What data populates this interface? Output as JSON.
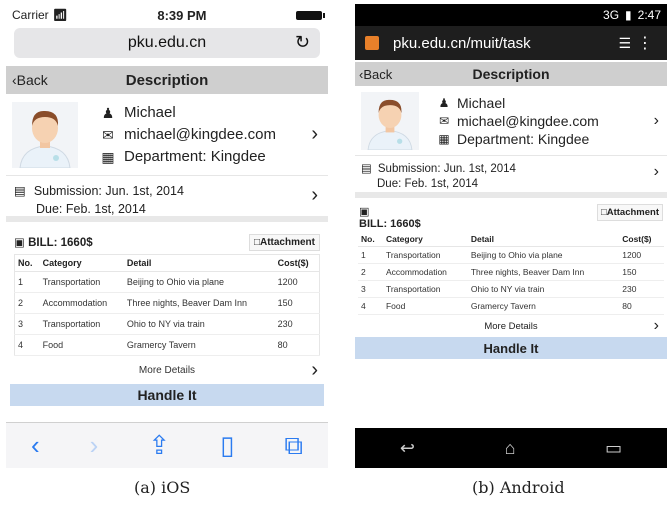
{
  "ios": {
    "status": {
      "carrier": "Carrier",
      "time": "8:39 PM"
    },
    "url": "pku.edu.cn",
    "nav": {
      "back": "Back",
      "title": "Description"
    },
    "profile": {
      "name": "Michael",
      "email": "michael@kingdee.com",
      "department": "Department: Kingdee"
    },
    "dates": {
      "submission": "Submission: Jun. 1st, 2014",
      "due": "Due: Feb. 1st, 2014"
    },
    "bill": {
      "label": "BILL: 1660$",
      "attachment": "Attachment"
    },
    "table": {
      "headers": [
        "No.",
        "Category",
        "Detail",
        "Cost($)"
      ],
      "rows": [
        [
          "1",
          "Transportation",
          "Beijing to Ohio via plane",
          "1200"
        ],
        [
          "2",
          "Accommodation",
          "Three nights, Beaver Dam Inn",
          "150"
        ],
        [
          "3",
          "Transportation",
          "Ohio to NY via train",
          "230"
        ],
        [
          "4",
          "Food",
          "Gramercy Tavern",
          "80"
        ]
      ]
    },
    "more": "More Details",
    "handle": "Handle It",
    "caption": "(a) iOS"
  },
  "android": {
    "status": {
      "time": "2:47",
      "network": "3G"
    },
    "url": "pku.edu.cn/muit/task",
    "nav": {
      "back": "Back",
      "title": "Description"
    },
    "profile": {
      "name": "Michael",
      "email": "michael@kingdee.com",
      "department": "Department: Kingdee"
    },
    "dates": {
      "submission": "Submission: Jun. 1st, 2014",
      "due": "Due: Feb. 1st, 2014"
    },
    "bill": {
      "label": "BILL: 1660$",
      "attachment": "Attachment"
    },
    "table": {
      "headers": [
        "No.",
        "Category",
        "Detail",
        "Cost($)"
      ],
      "rows": [
        [
          "1",
          "Transportation",
          "Beijing to Ohio via plane",
          "1200"
        ],
        [
          "2",
          "Accommodation",
          "Three nights, Beaver Dam Inn",
          "150"
        ],
        [
          "3",
          "Transportation",
          "Ohio to NY via train",
          "230"
        ],
        [
          "4",
          "Food",
          "Gramercy Tavern",
          "80"
        ]
      ]
    },
    "more": "More Details",
    "handle": "Handle It",
    "caption": "(b) Android"
  },
  "colors": {
    "nav_bg": "#cfcfcf",
    "handle_bg": "#c7d9ef",
    "ios_accent": "#2b7bf0",
    "android_bar": "#1e1e1e"
  }
}
